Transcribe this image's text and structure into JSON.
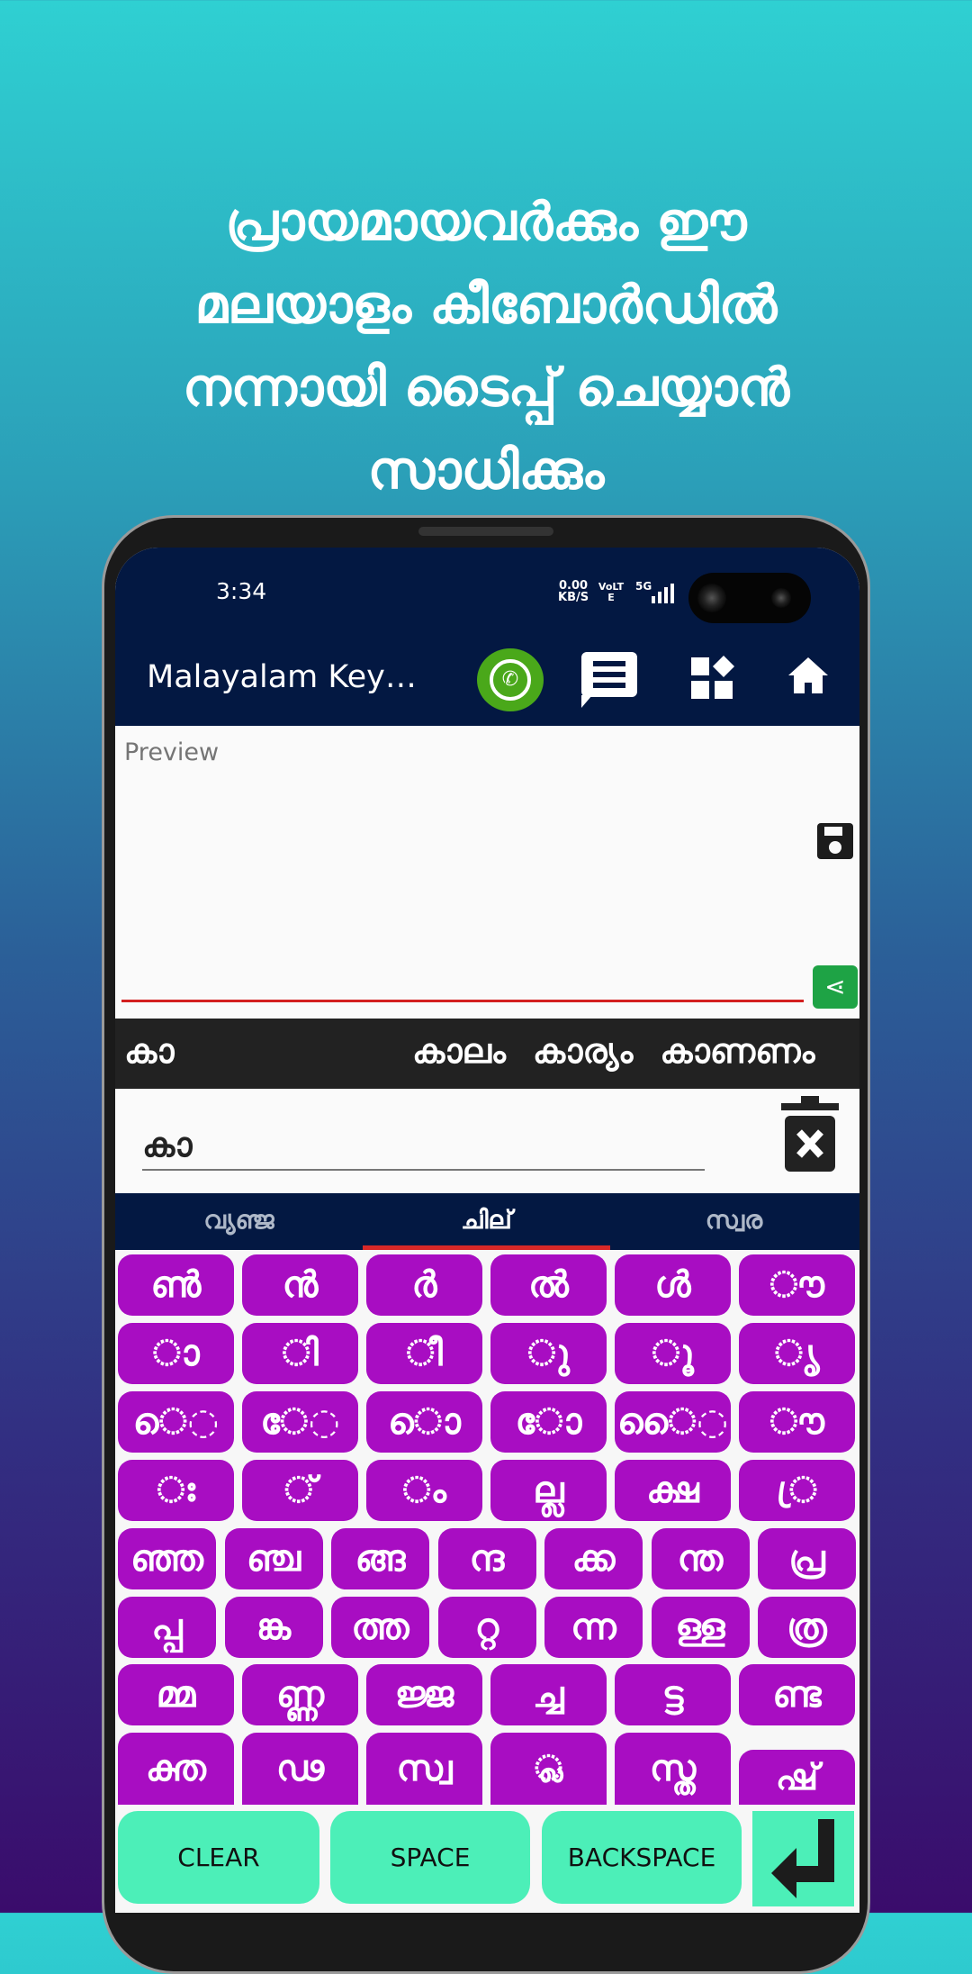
{
  "headline": [
    "പ്രായമായവർക്കും ഈ",
    "മലയാളം കീബോർഡിൽ",
    "നന്നായി ടൈപ്പ് ചെയ്യാൻ",
    "സാധിക്കും"
  ],
  "status": {
    "time": "3:34",
    "net_speed": "0.00",
    "net_unit": "KB/S",
    "volte": "VoLTE",
    "signal": "5G"
  },
  "appbar": {
    "title": "Malayalam Key…",
    "icons": [
      "whatsapp-icon",
      "chat-icon",
      "widgets-icon",
      "home-icon"
    ]
  },
  "preview": {
    "placeholder": "Preview",
    "value": ""
  },
  "suggestions": {
    "current": "കാ",
    "words": [
      "കാലം",
      "കാര്യം",
      "കാണണം"
    ]
  },
  "input": {
    "value": "കാ"
  },
  "tabs": [
    {
      "label": "വ്യഞ്ജ",
      "active": false
    },
    {
      "label": "ചില്",
      "active": true
    },
    {
      "label": "സ്വര",
      "active": false
    }
  ],
  "keyboard": {
    "rows": [
      [
        "ൺ",
        "ൻ",
        "ർ",
        "ൽ",
        "ൾ",
        "◌ൗ"
      ],
      [
        "◌ാ",
        "◌ി",
        "◌ീ",
        "◌ു",
        "◌ൂ",
        "◌ൃ"
      ],
      [
        "െ◌",
        "േ◌",
        "ൊ",
        "ോ",
        "ൈ◌",
        "◌ൗ"
      ],
      [
        "◌ഃ",
        "◌്",
        "◌ം",
        "ല്ല",
        "ക്ഷ",
        "◌്ര"
      ],
      [
        "ഞ്ഞ",
        "ഞ്ച",
        "ങ്ങ",
        "ന്ദ",
        "ക്ക",
        "ന്ത",
        "പ്ര"
      ],
      [
        "പ്പ",
        "ങ്ക",
        "ത്ത",
        "റ്റ",
        "ന്ന",
        "ള്ള",
        "ത്ര"
      ],
      [
        "മ്മ",
        "ണ്ണ",
        "ജ്ജ",
        "ച്ച",
        "ട്ട",
        "ണ്ട"
      ],
      [
        "ക്ത",
        "ഢ",
        "സ്വ",
        "◌്ല",
        "സ്ത",
        "ഷ്"
      ]
    ],
    "key_color": "#a80dc2",
    "function_keys": {
      "clear": "CLEAR",
      "space": "SPACE",
      "backspace": "BACKSPACE",
      "enter_icon": "enter-arrow-icon"
    },
    "function_color": "#4cefb8"
  }
}
